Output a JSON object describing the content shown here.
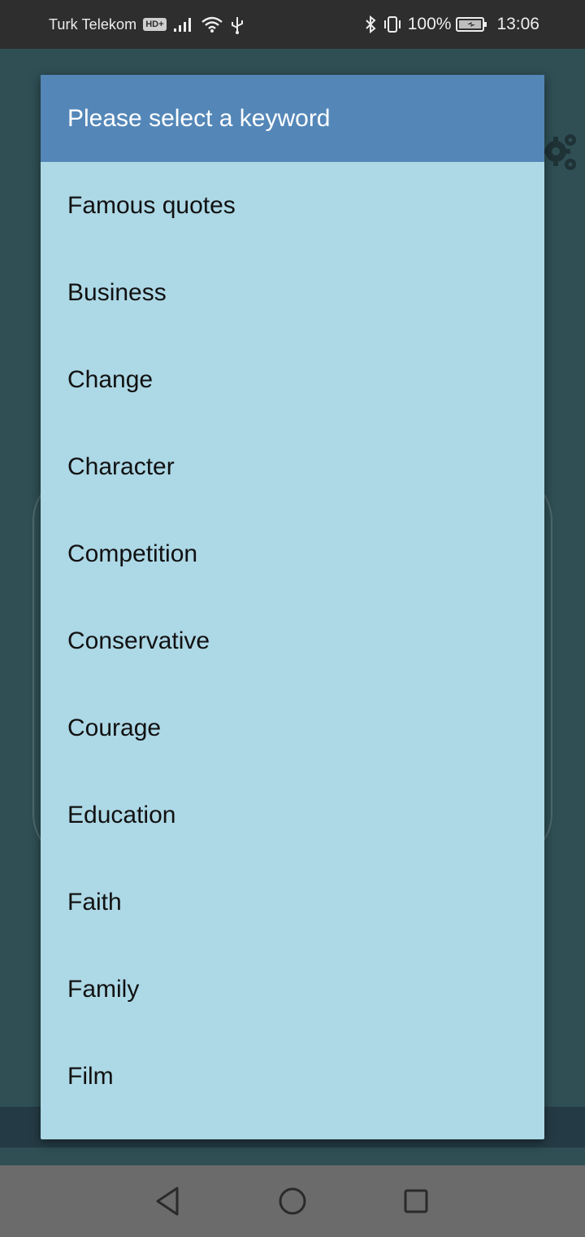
{
  "status_bar": {
    "carrier": "Turk Telekom",
    "hd_badge": "HD+",
    "battery_percent": "100%",
    "time": "13:06",
    "icons": [
      "signal-icon",
      "wifi-icon",
      "usb-icon",
      "bluetooth-icon",
      "vibrate-icon",
      "battery-charging-icon"
    ]
  },
  "dialog": {
    "title": "Please select a keyword",
    "items": [
      "Famous quotes",
      "Business",
      "Change",
      "Character",
      "Competition",
      "Conservative",
      "Courage",
      "Education",
      "Faith",
      "Family",
      "Film"
    ]
  },
  "nav_bar": {
    "icons": [
      "back-icon",
      "home-icon",
      "recent-apps-icon"
    ]
  },
  "colors": {
    "dialog_header": "#5487b8",
    "dialog_body": "#add8e6",
    "scrim_background": "#2f4f55",
    "status_bar": "#2e2e2e",
    "nav_bar": "#6b6b6b"
  }
}
